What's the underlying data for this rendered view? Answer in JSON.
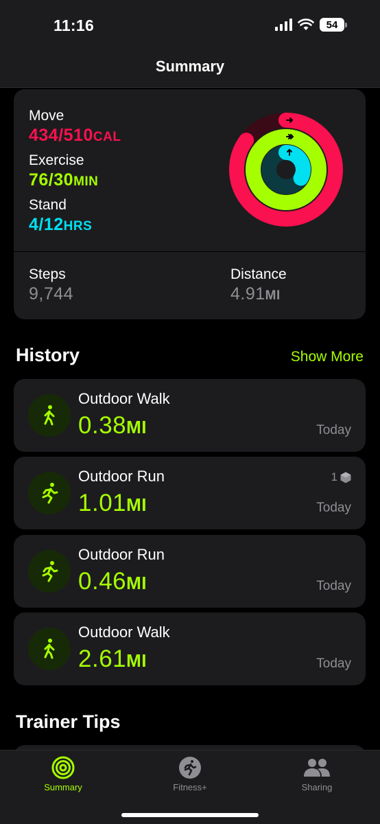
{
  "status": {
    "time": "11:16",
    "battery": "54"
  },
  "nav": {
    "title": "Summary"
  },
  "rings": {
    "move": {
      "label": "Move",
      "value": "434/510",
      "unit": "CAL",
      "progress": 0.851,
      "color": "#fa114f"
    },
    "exercise": {
      "label": "Exercise",
      "value": "76/30",
      "unit": "MIN",
      "progress": 2.533,
      "color": "#a6ff00"
    },
    "stand": {
      "label": "Stand",
      "value": "4/12",
      "unit": "HRS",
      "progress": 0.333,
      "color": "#00e0f0"
    }
  },
  "stats": {
    "steps": {
      "label": "Steps",
      "value": "9,744"
    },
    "distance": {
      "label": "Distance",
      "value": "4.91",
      "unit": "MI"
    }
  },
  "history": {
    "title": "History",
    "show_more": "Show More",
    "workouts": [
      {
        "name": "Outdoor Walk",
        "value": "0.38",
        "unit": "MI",
        "date": "Today",
        "icon": "walk-icon"
      },
      {
        "name": "Outdoor Run",
        "value": "1.01",
        "unit": "MI",
        "date": "Today",
        "icon": "run-icon",
        "badge": "1"
      },
      {
        "name": "Outdoor Run",
        "value": "0.46",
        "unit": "MI",
        "date": "Today",
        "icon": "run-icon"
      },
      {
        "name": "Outdoor Walk",
        "value": "2.61",
        "unit": "MI",
        "date": "Today",
        "icon": "walk-icon"
      }
    ]
  },
  "trainer_tips": {
    "title": "Trainer Tips"
  },
  "tabs": [
    {
      "label": "Summary",
      "icon": "summary-rings-icon",
      "active": true
    },
    {
      "label": "Fitness+",
      "icon": "fitness-plus-icon",
      "active": false
    },
    {
      "label": "Sharing",
      "icon": "sharing-people-icon",
      "active": false
    }
  ],
  "colors": {
    "accent": "#a6ff00",
    "move": "#fa114f",
    "stand": "#00e0f0"
  }
}
